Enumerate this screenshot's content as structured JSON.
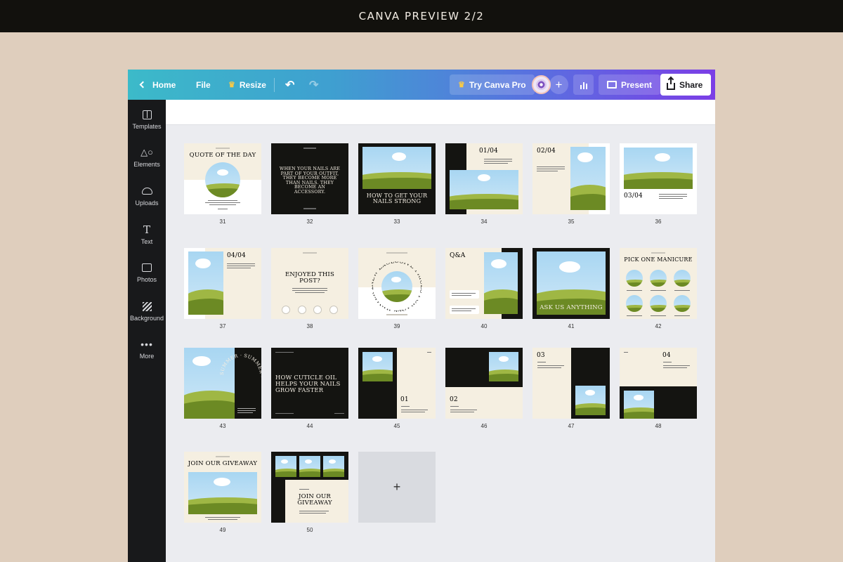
{
  "banner": {
    "title": "CANVA PREVIEW 2/2"
  },
  "toolbar": {
    "home": "Home",
    "file": "File",
    "resize": "Resize",
    "try_pro": "Try Canva Pro",
    "present": "Present",
    "share": "Share"
  },
  "sidebar": {
    "items": [
      {
        "label": "Templates",
        "icon": "templates-icon"
      },
      {
        "label": "Elements",
        "icon": "elements-icon"
      },
      {
        "label": "Uploads",
        "icon": "upload-cloud-icon"
      },
      {
        "label": "Text",
        "icon": "text-icon"
      },
      {
        "label": "Photos",
        "icon": "photo-icon"
      },
      {
        "label": "Background",
        "icon": "background-icon"
      },
      {
        "label": "More",
        "icon": "more-dots-icon"
      }
    ]
  },
  "pages": {
    "p31": {
      "num": "31",
      "title": "QUOTE OF THE DAY"
    },
    "p32": {
      "num": "32",
      "title": "WHEN YOUR NAILS ARE PART OF YOUR OUTFIT, THEY BECOME MORE THAN NAILS. THEY BECOME AN ACCESSORY."
    },
    "p33": {
      "num": "33",
      "title": "HOW TO GET YOUR NAILS STRONG"
    },
    "p34": {
      "num": "34",
      "title": "01/04"
    },
    "p35": {
      "num": "35",
      "title": "02/04"
    },
    "p36": {
      "num": "36",
      "title": "03/04"
    },
    "p37": {
      "num": "37",
      "title": "04/04"
    },
    "p38": {
      "num": "38",
      "title": "ENJOYED THIS POST?"
    },
    "p39": {
      "num": "39",
      "title": "NEW EXCLUSIVE PRICES FOR FALL WINTER 2023"
    },
    "p40": {
      "num": "40",
      "title": "Q&A"
    },
    "p41": {
      "num": "41",
      "title": "ASK US ANYTHING"
    },
    "p42": {
      "num": "42",
      "title": "PICK ONE MANICURE"
    },
    "p43": {
      "num": "43",
      "title": "SUMMER · SUMMER ·"
    },
    "p44": {
      "num": "44",
      "title": "HOW CUTICLE OIL HELPS YOUR NAILS GROW FASTER"
    },
    "p45": {
      "num": "45",
      "title": "01"
    },
    "p46": {
      "num": "46",
      "title": "02"
    },
    "p47": {
      "num": "47",
      "title": "03"
    },
    "p48": {
      "num": "48",
      "title": "04"
    },
    "p49": {
      "num": "49",
      "title": "JOIN OUR GIVEAWAY"
    },
    "p50": {
      "num": "50",
      "title": "JOIN OUR GIVEAWAY"
    },
    "add_page": {
      "symbol": "+"
    }
  },
  "colors": {
    "cream": "#f5efe1",
    "black": "#141411",
    "sky": "#a8d6f2",
    "grass": "#9fb744",
    "grass_dark": "#6c8a24",
    "toolbar_start": "#3cbac9",
    "toolbar_end": "#7b3ee6"
  }
}
